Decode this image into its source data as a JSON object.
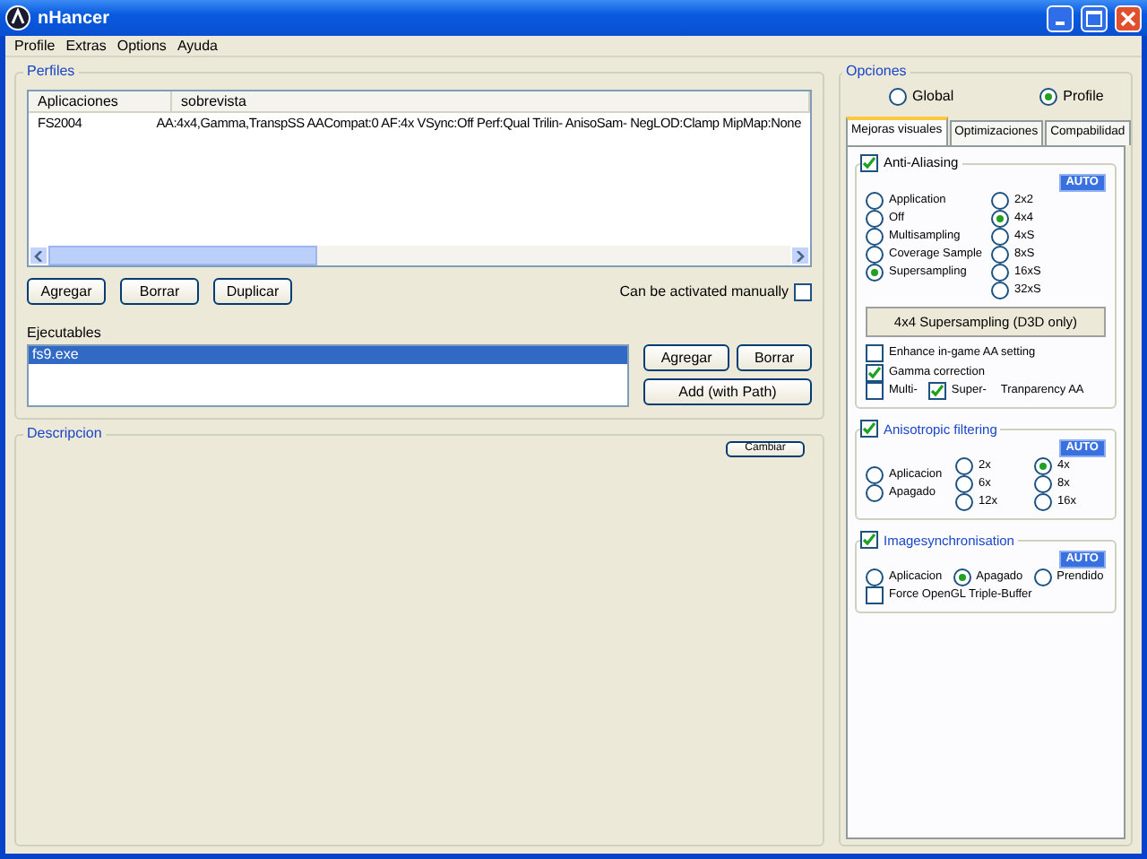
{
  "window": {
    "title": "nHancer"
  },
  "menu": [
    "Profile",
    "Extras",
    "Options",
    "Ayuda"
  ],
  "perfiles": {
    "legend": "Perfiles",
    "columns": [
      "Aplicaciones",
      "sobrevista"
    ],
    "rows": [
      {
        "cells": [
          "FS2004",
          "AA:4x4,Gamma,TranspSS AACompat:0 AF:4x VSync:Off Perf:Qual Trilin- AnisoSam- NegLOD:Clamp MipMap:None"
        ],
        "selected": false
      }
    ],
    "buttons": [
      "Agregar",
      "Borrar",
      "Duplicar"
    ],
    "manual": {
      "label": "Can be activated manually",
      "checked": false
    }
  },
  "ejecutables": {
    "label": "Ejecutables",
    "items": [
      {
        "text": "fs9.exe",
        "selected": true
      }
    ],
    "buttons": [
      "Agregar",
      "Borrar",
      "Add (with Path)"
    ]
  },
  "descripcion": {
    "legend": "Descripcion",
    "button": "Cambiar"
  },
  "opciones": {
    "legend": "Opciones",
    "scope": [
      {
        "label": "Global",
        "selected": false
      },
      {
        "label": "Profile",
        "selected": true
      }
    ],
    "tabs": [
      {
        "label": "Mejoras visuales",
        "selected": true
      },
      {
        "label": "Optimizaciones",
        "selected": false
      },
      {
        "label": "Compabilidad",
        "selected": false
      }
    ],
    "anti_aliasing": {
      "label": "Anti-Aliasing",
      "checked": true,
      "badge": "AUTO",
      "modes": [
        {
          "label": "Application",
          "selected": false
        },
        {
          "label": "Off",
          "selected": false
        },
        {
          "label": "Multisampling",
          "selected": false
        },
        {
          "label": "Coverage Sample",
          "selected": false
        },
        {
          "label": "Supersampling",
          "selected": true
        }
      ],
      "samples": [
        {
          "label": "2x2",
          "selected": false
        },
        {
          "label": "4x4",
          "selected": true
        },
        {
          "label": "4xS",
          "selected": false
        },
        {
          "label": "8xS",
          "selected": false
        },
        {
          "label": "16xS",
          "selected": false
        },
        {
          "label": "32xS",
          "selected": false
        }
      ],
      "readout": "4x4 Supersampling (D3D only)",
      "enhance": {
        "label": "Enhance in-game AA setting",
        "checked": false
      },
      "gamma": {
        "label": "Gamma correction",
        "checked": true
      },
      "transparency": {
        "multi": {
          "label": "Multi-",
          "checked": false
        },
        "super": {
          "label": "Super-",
          "checked": true
        },
        "label": "Tranparency AA"
      }
    },
    "anisotropic": {
      "label": "Anisotropic filtering",
      "checked": true,
      "badge": "AUTO",
      "modes": [
        {
          "label": "Aplicacion",
          "selected": false
        },
        {
          "label": "Apagado",
          "selected": false
        }
      ],
      "levels": [
        {
          "label": "2x",
          "selected": false
        },
        {
          "label": "6x",
          "selected": false
        },
        {
          "label": "12x",
          "selected": false
        },
        {
          "label": "4x",
          "selected": true
        },
        {
          "label": "8x",
          "selected": false
        },
        {
          "label": "16x",
          "selected": false
        }
      ]
    },
    "vsync": {
      "label": "Imagesynchronisation",
      "checked": true,
      "badge": "AUTO",
      "options": [
        {
          "label": "Aplicacion",
          "selected": false
        },
        {
          "label": "Apagado",
          "selected": true
        },
        {
          "label": "Prendido",
          "selected": false
        }
      ],
      "triple_buffer": {
        "label": "Force OpenGL Triple-Buffer",
        "checked": false
      }
    }
  }
}
